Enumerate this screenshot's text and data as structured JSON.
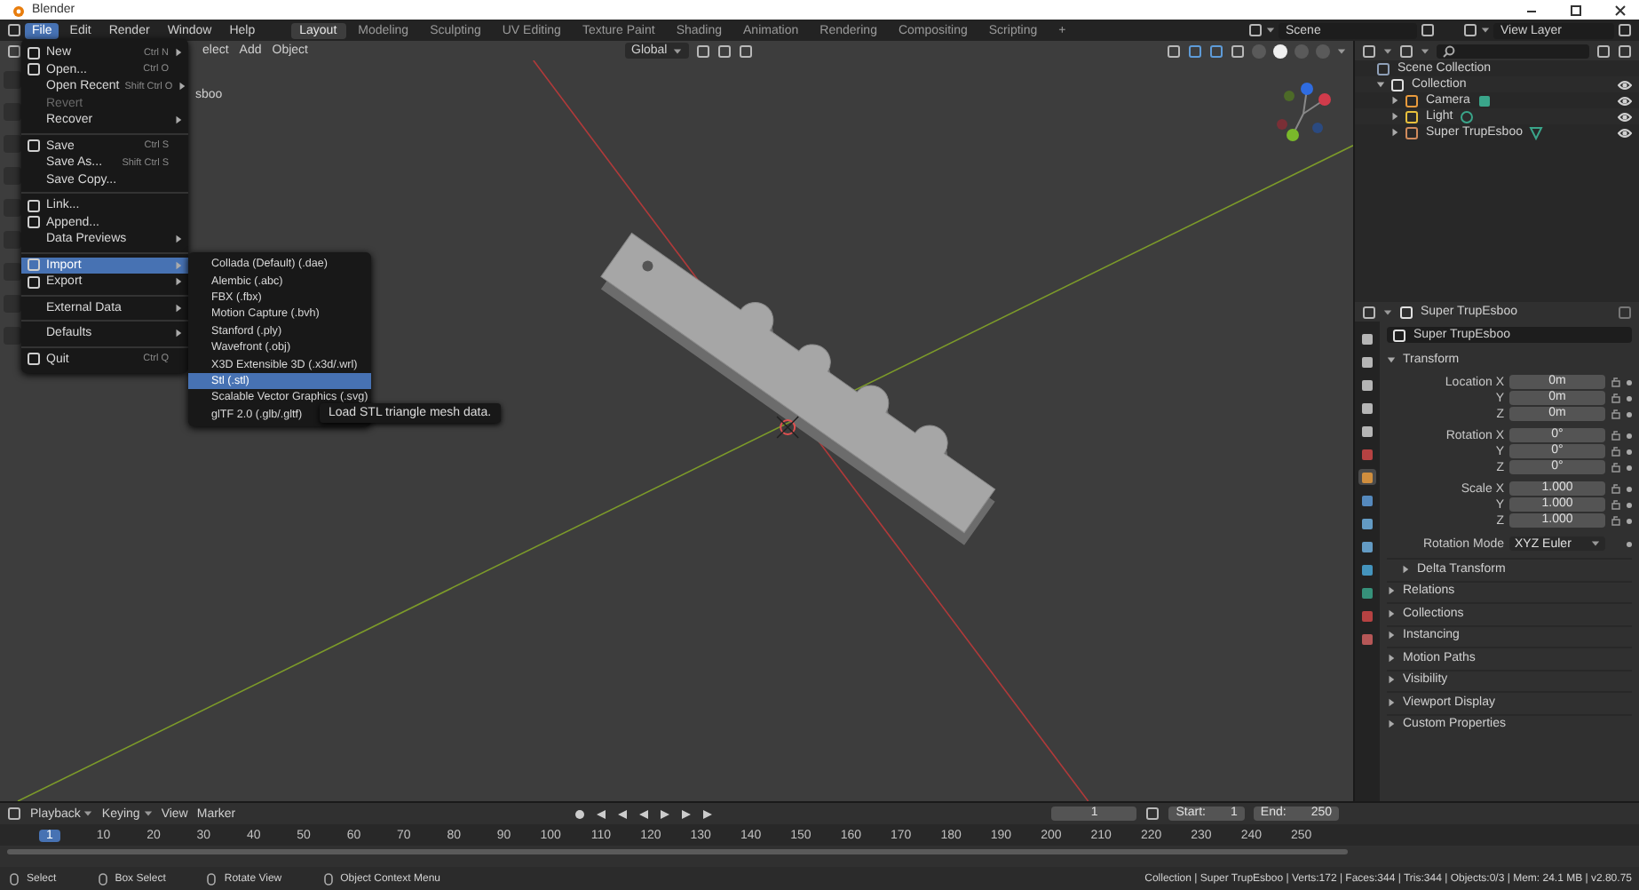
{
  "window": {
    "title": "Blender"
  },
  "menubar": [
    {
      "label": "File",
      "selected": true
    },
    {
      "label": "Edit",
      "selected": false
    },
    {
      "label": "Render",
      "selected": false
    },
    {
      "label": "Window",
      "selected": false
    },
    {
      "label": "Help",
      "selected": false
    }
  ],
  "workspaces": [
    {
      "label": "Layout",
      "selected": true
    },
    {
      "label": "Modeling",
      "selected": false
    },
    {
      "label": "Sculpting",
      "selected": false
    },
    {
      "label": "UV Editing",
      "selected": false
    },
    {
      "label": "Texture Paint",
      "selected": false
    },
    {
      "label": "Shading",
      "selected": false
    },
    {
      "label": "Animation",
      "selected": false
    },
    {
      "label": "Rendering",
      "selected": false
    },
    {
      "label": "Compositing",
      "selected": false
    },
    {
      "label": "Scripting",
      "selected": false
    }
  ],
  "add_workspace": "+",
  "scene": {
    "scene": "Scene",
    "view_layer": "View Layer"
  },
  "viewport": {
    "menus": [
      "elect",
      "Add",
      "Object"
    ],
    "orientation": "Global",
    "overlay_label": "sboo",
    "shading_modes": [
      {
        "selected": false
      },
      {
        "selected": true
      },
      {
        "selected": false
      },
      {
        "selected": false
      }
    ]
  },
  "file_menu": [
    {
      "kind": "item",
      "label": "New",
      "shortcut": "Ctrl N",
      "submenu": true,
      "icon": true,
      "disabled": false,
      "selected": false
    },
    {
      "kind": "item",
      "label": "Open...",
      "shortcut": "Ctrl O",
      "submenu": false,
      "icon": true,
      "disabled": false,
      "selected": false
    },
    {
      "kind": "item",
      "label": "Open Recent",
      "shortcut": "Shift Ctrl O",
      "submenu": true,
      "icon": false,
      "disabled": false,
      "selected": false
    },
    {
      "kind": "item",
      "label": "Revert",
      "submenu": false,
      "icon": false,
      "disabled": true,
      "selected": false
    },
    {
      "kind": "item",
      "label": "Recover",
      "submenu": true,
      "icon": false,
      "disabled": false,
      "selected": false
    },
    {
      "kind": "separator"
    },
    {
      "kind": "item",
      "label": "Save",
      "shortcut": "Ctrl S",
      "submenu": false,
      "icon": true,
      "disabled": false,
      "selected": false
    },
    {
      "kind": "item",
      "label": "Save As...",
      "shortcut": "Shift Ctrl S",
      "submenu": false,
      "icon": false,
      "disabled": false,
      "selected": false
    },
    {
      "kind": "item",
      "label": "Save Copy...",
      "submenu": false,
      "icon": false,
      "disabled": false,
      "selected": false
    },
    {
      "kind": "separator"
    },
    {
      "kind": "item",
      "label": "Link...",
      "submenu": false,
      "icon": true,
      "disabled": false,
      "selected": false
    },
    {
      "kind": "item",
      "label": "Append...",
      "submenu": false,
      "icon": true,
      "disabled": false,
      "selected": false
    },
    {
      "kind": "item",
      "label": "Data Previews",
      "submenu": true,
      "icon": false,
      "disabled": false,
      "selected": false
    },
    {
      "kind": "separator"
    },
    {
      "kind": "item",
      "label": "Import",
      "submenu": true,
      "icon": true,
      "disabled": false,
      "selected": true
    },
    {
      "kind": "item",
      "label": "Export",
      "submenu": true,
      "icon": true,
      "disabled": false,
      "selected": false
    },
    {
      "kind": "separator"
    },
    {
      "kind": "item",
      "label": "External Data",
      "submenu": true,
      "icon": false,
      "disabled": false,
      "selected": false
    },
    {
      "kind": "separator"
    },
    {
      "kind": "item",
      "label": "Defaults",
      "submenu": true,
      "icon": false,
      "disabled": false,
      "selected": false
    },
    {
      "kind": "separator"
    },
    {
      "kind": "item",
      "label": "Quit",
      "shortcut": "Ctrl Q",
      "submenu": false,
      "icon": true,
      "disabled": false,
      "selected": false
    }
  ],
  "import_menu": [
    {
      "label": "Collada (Default) (.dae)",
      "selected": false
    },
    {
      "label": "Alembic (.abc)",
      "selected": false
    },
    {
      "label": "FBX (.fbx)",
      "selected": false
    },
    {
      "label": "Motion Capture (.bvh)",
      "selected": false
    },
    {
      "label": "Stanford (.ply)",
      "selected": false
    },
    {
      "label": "Wavefront (.obj)",
      "selected": false
    },
    {
      "label": "X3D Extensible 3D (.x3d/.wrl)",
      "selected": false
    },
    {
      "label": "Stl (.stl)",
      "selected": true
    },
    {
      "label": "Scalable Vector Graphics (.svg)",
      "selected": false
    },
    {
      "label": "glTF 2.0 (.glb/.gltf)",
      "selected": false
    }
  ],
  "tooltip": "Load STL triangle mesh data.",
  "outliner": {
    "tree": [
      {
        "kind": "scene_collection",
        "label": "Scene Collection",
        "children": [
          {
            "kind": "collection",
            "label": "Collection",
            "expanded": true,
            "visible": true,
            "children": [
              {
                "kind": "camera",
                "label": "Camera",
                "expanded": false,
                "visible": true
              },
              {
                "kind": "light",
                "label": "Light",
                "expanded": false,
                "visible": true
              },
              {
                "kind": "mesh",
                "label": "Super TrupEsboo",
                "expanded": false,
                "visible": true
              }
            ]
          }
        ]
      }
    ]
  },
  "properties": {
    "object_name": "Super TrupEsboo",
    "name_field": "Super TrupEsboo",
    "tabs": [
      {
        "selected": false
      },
      {
        "selected": false
      },
      {
        "selected": false
      },
      {
        "selected": false
      },
      {
        "selected": false
      },
      {
        "selected": false
      },
      {
        "selected": true
      },
      {
        "selected": false
      },
      {
        "selected": false
      },
      {
        "selected": false
      },
      {
        "selected": false
      },
      {
        "selected": false
      },
      {
        "selected": false
      },
      {
        "selected": false
      }
    ],
    "transform": {
      "label": "Transform",
      "expanded": true,
      "groups": [
        [
          {
            "label": "Location X",
            "value": "0m"
          },
          {
            "label": "Y",
            "value": "0m"
          },
          {
            "label": "Z",
            "value": "0m"
          }
        ],
        [
          {
            "label": "Rotation X",
            "value": "0°"
          },
          {
            "label": "Y",
            "value": "0°"
          },
          {
            "label": "Z",
            "value": "0°"
          }
        ],
        [
          {
            "label": "Scale X",
            "value": "1.000"
          },
          {
            "label": "Y",
            "value": "1.000"
          },
          {
            "label": "Z",
            "value": "1.000"
          }
        ]
      ],
      "rotation_mode": {
        "label": "Rotation Mode",
        "value": "XYZ Euler"
      },
      "subpanels": [
        {
          "label": "Delta Transform",
          "expanded": false
        }
      ]
    },
    "panels": [
      {
        "label": "Relations",
        "expanded": false
      },
      {
        "label": "Collections",
        "expanded": false
      },
      {
        "label": "Instancing",
        "expanded": false
      },
      {
        "label": "Motion Paths",
        "expanded": false
      },
      {
        "label": "Visibility",
        "expanded": false
      },
      {
        "label": "Viewport Display",
        "expanded": false
      },
      {
        "label": "Custom Properties",
        "expanded": false
      }
    ]
  },
  "timeline": {
    "menus": [
      {
        "label": "Playback",
        "dropdown": true
      },
      {
        "label": "Keying",
        "dropdown": true
      },
      {
        "label": "View",
        "dropdown": false
      },
      {
        "label": "Marker",
        "dropdown": false
      }
    ],
    "current_frame": "1",
    "start_label": "Start:",
    "start": "1",
    "end_label": "End:",
    "end": "250",
    "playhead": "1",
    "ruler": [
      "10",
      "20",
      "30",
      "40",
      "50",
      "60",
      "70",
      "80",
      "90",
      "100",
      "110",
      "120",
      "130",
      "140",
      "150",
      "160",
      "170",
      "180",
      "190",
      "200",
      "210",
      "220",
      "230",
      "240",
      "250"
    ]
  },
  "status_bar": {
    "hints": [
      {
        "label": "Select"
      },
      {
        "label": "Box Select"
      },
      {
        "label": "Rotate View"
      },
      {
        "label": "Object Context Menu"
      }
    ],
    "stats": "Collection | Super TrupEsboo | Verts:172 | Faces:344 | Tris:344 | Objects:0/3 | Mem: 24.1 MB | v2.80.75"
  }
}
